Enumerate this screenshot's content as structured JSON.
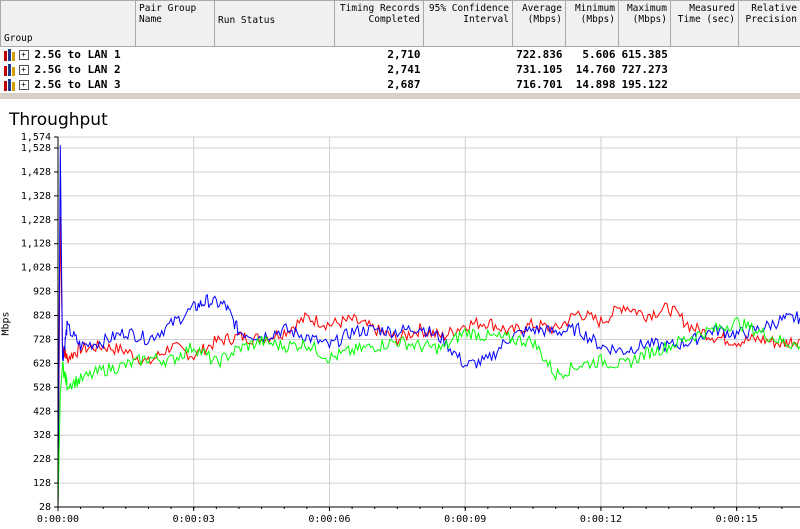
{
  "results_table": {
    "columns": [
      {
        "label": "Group"
      },
      {
        "label": "Pair Group\nName"
      },
      {
        "label": "Run Status"
      },
      {
        "label": "Timing Records\nCompleted"
      },
      {
        "label": "95% Confidence\nInterval"
      },
      {
        "label": "Average\n(Mbps)"
      },
      {
        "label": "Minimum\n(Mbps)"
      },
      {
        "label": "Maximum\n(Mbps)"
      },
      {
        "label": "Measured\nTime (sec)"
      },
      {
        "label": "Relative\nPrecision"
      }
    ],
    "rows": [
      {
        "group": "2.5G to LAN 1",
        "records": "2,710",
        "average": "722.836",
        "minimum": "5.606",
        "maximum": "615.385"
      },
      {
        "group": "2.5G to LAN 2",
        "records": "2,741",
        "average": "731.105",
        "minimum": "14.760",
        "maximum": "727.273"
      },
      {
        "group": "2.5G to LAN 3",
        "records": "2,687",
        "average": "716.701",
        "minimum": "14.898",
        "maximum": "195.122"
      }
    ],
    "expand_glyph": "+"
  },
  "chart_data": {
    "type": "line",
    "title": "Throughput",
    "ylabel": "Mbps",
    "xlabel": "",
    "ylim": [
      28,
      1574
    ],
    "xlim": [
      0,
      16.4
    ],
    "yticks": [
      "28",
      "128",
      "228",
      "328",
      "428",
      "528",
      "628",
      "728",
      "828",
      "928",
      "1,028",
      "1,128",
      "1,228",
      "1,328",
      "1,428",
      "1,528",
      "1,574"
    ],
    "ytick_values": [
      28,
      128,
      228,
      328,
      428,
      528,
      628,
      728,
      828,
      928,
      1028,
      1128,
      1228,
      1328,
      1428,
      1528,
      1574
    ],
    "xticks": [
      "0:00:00",
      "0:00:03",
      "0:00:06",
      "0:00:09",
      "0:00:12",
      "0:00:15"
    ],
    "xtick_values": [
      0,
      3,
      6,
      9,
      12,
      15
    ],
    "grid": true,
    "series": [
      {
        "color": "#ff0000",
        "x": [
          0,
          0.05,
          0.1,
          0.2,
          0.5,
          1.0,
          1.5,
          2.0,
          2.5,
          3.0,
          3.5,
          4.0,
          4.5,
          5.0,
          5.5,
          6.0,
          6.5,
          7.0,
          7.5,
          8.0,
          8.5,
          9.0,
          9.5,
          10.0,
          10.5,
          11.0,
          11.5,
          12.0,
          12.5,
          13.0,
          13.5,
          14.0,
          14.5,
          15.0,
          15.5,
          16.0,
          16.4
        ],
        "values": [
          28,
          1240,
          700,
          650,
          690,
          700,
          680,
          630,
          700,
          660,
          720,
          740,
          730,
          760,
          820,
          790,
          810,
          770,
          730,
          770,
          740,
          790,
          800,
          760,
          790,
          770,
          840,
          800,
          870,
          830,
          860,
          780,
          740,
          720,
          730,
          710,
          730
        ]
      },
      {
        "color": "#0000ff",
        "x": [
          0,
          0.05,
          0.1,
          0.2,
          0.5,
          1.0,
          1.5,
          2.0,
          2.5,
          3.0,
          3.3,
          3.7,
          4.0,
          4.5,
          5.0,
          5.5,
          6.0,
          6.5,
          7.0,
          7.5,
          8.0,
          8.5,
          9.0,
          9.5,
          10.0,
          10.5,
          11.0,
          11.5,
          12.0,
          12.5,
          13.0,
          13.5,
          14.0,
          14.5,
          15.0,
          15.5,
          16.0,
          16.4
        ],
        "values": [
          28,
          1540,
          640,
          780,
          700,
          720,
          760,
          730,
          790,
          860,
          890,
          870,
          760,
          740,
          770,
          740,
          700,
          760,
          770,
          760,
          780,
          730,
          620,
          640,
          740,
          770,
          760,
          770,
          700,
          680,
          710,
          700,
          720,
          770,
          750,
          770,
          810,
          820
        ]
      },
      {
        "color": "#00ff00",
        "x": [
          0,
          0.05,
          0.1,
          0.2,
          0.5,
          1.0,
          1.5,
          2.0,
          2.5,
          3.0,
          3.5,
          4.0,
          4.5,
          5.0,
          5.5,
          6.0,
          6.5,
          7.0,
          7.5,
          8.0,
          8.5,
          9.0,
          9.5,
          10.0,
          10.5,
          11.0,
          11.5,
          12.0,
          12.5,
          13.0,
          13.5,
          14.0,
          14.5,
          15.0,
          15.5,
          16.0,
          16.4
        ],
        "values": [
          28,
          500,
          620,
          540,
          560,
          600,
          620,
          650,
          640,
          700,
          630,
          690,
          720,
          700,
          710,
          650,
          680,
          700,
          720,
          700,
          690,
          760,
          740,
          730,
          720,
          580,
          620,
          640,
          620,
          670,
          700,
          740,
          770,
          800,
          760,
          720,
          700
        ]
      }
    ]
  },
  "colors": {
    "header_bg": "#f0f0f0",
    "grid": "#d0d0d0",
    "axis": "#808080"
  }
}
